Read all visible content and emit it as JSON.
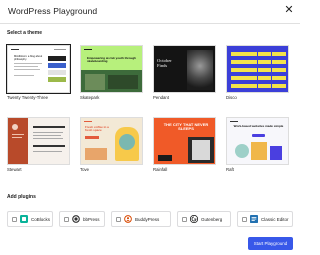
{
  "dialog": {
    "title": "WordPress Playground",
    "close_glyph": "✕"
  },
  "themes_section": {
    "label": "Select a theme",
    "selected": "Twenty Twenty-Three",
    "themes": [
      {
        "name": "Twenty Twenty-Three",
        "preview_text": "Mindblown: a blog about philosophy."
      },
      {
        "name": "Skatepark",
        "preview_text": "Empowering at-risk youth through skateboarding"
      },
      {
        "name": "Pendant",
        "preview_text": "October Finds"
      },
      {
        "name": "Disco",
        "preview_text": ""
      },
      {
        "name": "Stewart",
        "preview_text": ""
      },
      {
        "name": "Tove",
        "preview_text": "Fresh coffee in a fresh space"
      },
      {
        "name": "Rainfall",
        "preview_text": "THE CITY THAT NEVER SLEEPS"
      },
      {
        "name": "Raft",
        "preview_text": "Work-based websites made simple"
      }
    ]
  },
  "plugins_section": {
    "label": "Add plugins",
    "plugins": [
      {
        "name": "CoBlocks",
        "icon": "coblocks-icon"
      },
      {
        "name": "bbPress",
        "icon": "bbpress-icon"
      },
      {
        "name": "BuddyPress",
        "icon": "buddypress-icon"
      },
      {
        "name": "Gutenberg",
        "icon": "gutenberg-icon"
      },
      {
        "name": "Classic Editor",
        "icon": "classic-editor-icon"
      }
    ]
  },
  "actions": {
    "start_label": "Start Playground"
  },
  "colors": {
    "accent": "#3858e9",
    "selection": "#1e1e1e"
  }
}
